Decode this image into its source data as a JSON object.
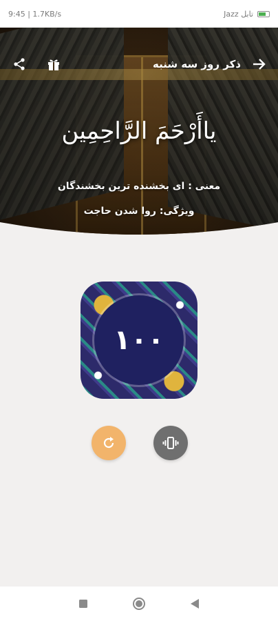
{
  "status_bar": {
    "time": "9:45 | 1.7KB/s",
    "carrier": "Jazz تابل"
  },
  "header": {
    "title": "ذکر روز سه شنبه",
    "dhikr": "ياأَرْحَمَ الرَّاحِمِين",
    "meaning": "معنی : ای بخشنده ترین بخشندگان",
    "feature": "ویژگی: روا شدن حاجت"
  },
  "icons": {
    "back": "arrow-right-icon",
    "gift": "gift-icon",
    "share": "share-icon",
    "reset": "refresh-icon",
    "vibrate": "vibrate-icon"
  },
  "counter": {
    "value": "١٠٠"
  },
  "colors": {
    "reset_button": "#f2b46b",
    "vibrate_button": "#6f6f6f",
    "counter_circle": "#1f2160",
    "background": "#f2f0ef"
  }
}
